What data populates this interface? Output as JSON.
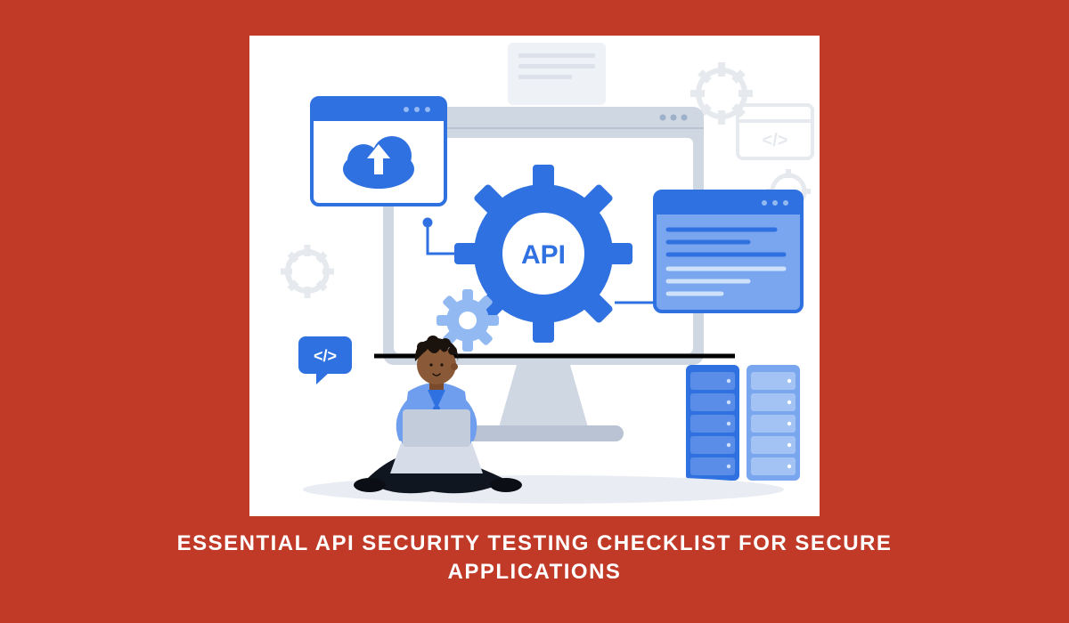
{
  "caption": "Essential API Security Testing Checklist for Secure Applications",
  "illustration": {
    "gear_label": "API",
    "code_glyph_1": "</>",
    "code_glyph_2": "</>"
  },
  "colors": {
    "background": "#c13a28",
    "primary_blue": "#2f71e0",
    "light_blue": "#93b9f2",
    "panel_blue": "#7aa6ef",
    "ghost_gray": "#e6e9ee",
    "dark_line": "#0f1a2b",
    "white": "#ffffff"
  }
}
